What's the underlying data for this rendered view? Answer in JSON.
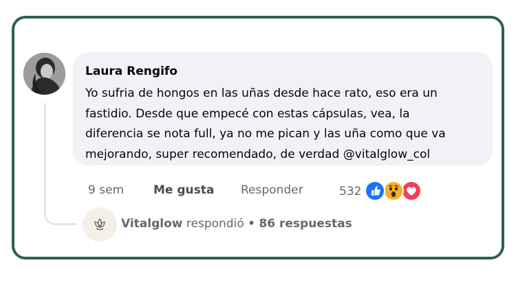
{
  "comment": {
    "author": "Laura Rengifo",
    "lines": [
      "Yo sufria de hongos en las uñas desde hace rato, eso era un",
      "fastidio. Desde que empecé con estas cápsulas, vea, la",
      "diferencia se nota full, ya no me pican y las uña como que va",
      "mejorando, super recomendado, de verdad @vitalglow_col"
    ],
    "time": "9 sem",
    "like_label": "Me gusta",
    "reply_label": "Responder",
    "reaction_count": "532",
    "reactions": [
      "like-icon",
      "wow-icon",
      "love-icon"
    ]
  },
  "reply_summary": {
    "page_name": "Vitalglow",
    "verb": "respondió",
    "separator": "•",
    "replies": "86 respuestas"
  },
  "colors": {
    "frame": "#2f5f55",
    "bubble": "#f0f2f5",
    "like": "#1877f2",
    "wow": "#f7b125",
    "love": "#f33e58"
  }
}
